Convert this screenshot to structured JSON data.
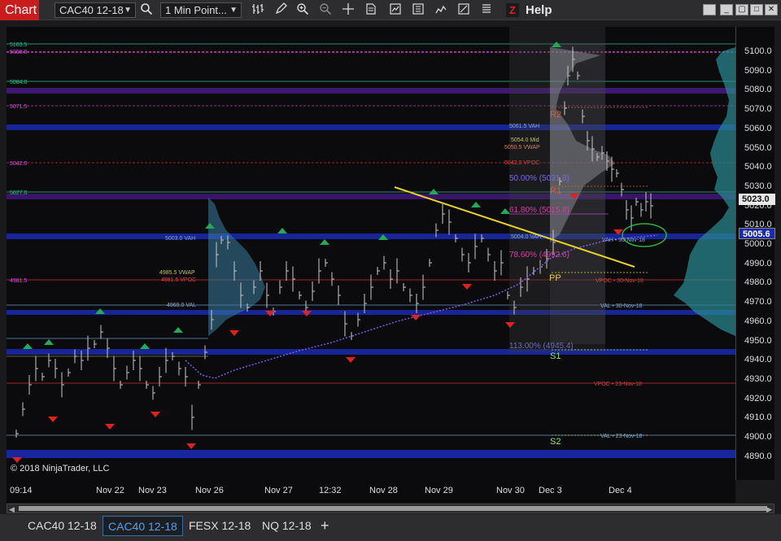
{
  "toolbar": {
    "chart_label": "Chart",
    "instrument": "CAC40 12-18",
    "interval": "1 Min Point...",
    "help_label": "Help",
    "z_label": "Z"
  },
  "copyright": "© 2018 NinjaTrader, LLC",
  "price_axis": {
    "ticks": [
      "5100.0",
      "5090.0",
      "5080.0",
      "5070.0",
      "5060.0",
      "5050.0",
      "5040.0",
      "5030.0",
      "5020.0",
      "5010.0",
      "5000.0",
      "4990.0",
      "4980.0",
      "4970.0",
      "4960.0",
      "4950.0",
      "4940.0",
      "4930.0",
      "4920.0",
      "4910.0",
      "4900.0",
      "4890.0"
    ],
    "last_price": "5023.0",
    "marker_price": "5005.6"
  },
  "time_axis": [
    "09:14",
    "Nov 22",
    "Nov 23",
    "Nov 26",
    "Nov 27",
    "12:32",
    "Nov 28",
    "Nov 29",
    "Nov 30",
    "Dec 3",
    "Dec 4"
  ],
  "level_labels": {
    "l5103": "5103.5",
    "l5099": "5099.0",
    "l5084": "5084.0",
    "l5071": "5071.5",
    "l5042": "5042.0",
    "l5027": "5027.0",
    "l4981": "4981.5",
    "vah5003": "5003.0 VAH",
    "val4969": "4969.0 VAL",
    "vwap4985": "4985.5 VWAP",
    "vpoc4981": "4981.5 VPOC",
    "vah5061": "5061.5 VAH",
    "mid5054": "5054.0 Mid",
    "vwap5050": "5050.5 VWAP",
    "vpoc5042": "5042.0 VPOC",
    "vah5004": "5004.0 VAH",
    "vah_tag": "VAH • 30-Nov-18",
    "vpoc_tag": "VPOC • 30-Nov-18",
    "val_tag": "VAL • 30-Nov-18",
    "vpoc23_tag": "VPOC • 23-Nov-18",
    "val23_tag": "VAL • 23-Nov-18"
  },
  "pivots": {
    "r2": "R2",
    "r1": "R1",
    "pp": "PP",
    "s1": "S1",
    "s2": "S2"
  },
  "fibs": {
    "f50": "50.00% (5031.8)",
    "f618": "61.80% (5015.8)",
    "f786": "78.60% (4992.6)",
    "f113": "113.00% (4945.4)"
  },
  "bottom_tabs": [
    "CAC40 12-18",
    "CAC40 12-18",
    "FESX 12-18",
    "NQ 12-18"
  ],
  "add_tab_label": "+",
  "colors": {
    "chart_tab": "#c91c1c",
    "active_tab": "#4aa3f0",
    "trendline": "#e8d22a",
    "up_marker": "#22aa55",
    "down_marker": "#dd2222",
    "vpoc_line": "#c83030",
    "value_area_band": "#1a2ab0",
    "volume_profile": "#3a7ea0"
  }
}
